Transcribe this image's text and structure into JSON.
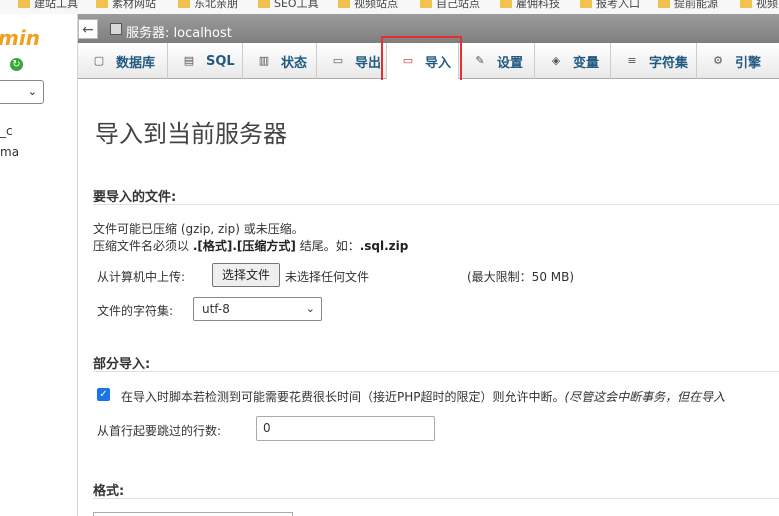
{
  "bookmarks": [
    "建站工具",
    "素材网站",
    "东北亲朋",
    "SEO工具",
    "视频站点",
    "自己站点",
    "雇佣科技",
    "报考入口",
    "提前能源",
    "视频"
  ],
  "sidebar": {
    "logo": "min",
    "items": [
      "_c",
      "ma"
    ]
  },
  "serverbar": {
    "back": "←",
    "label": "服务器: localhost"
  },
  "tabs": [
    {
      "label": "数据库",
      "icon": "database-icon"
    },
    {
      "label": "SQL",
      "icon": "sql-icon"
    },
    {
      "label": "状态",
      "icon": "status-icon"
    },
    {
      "label": "导出",
      "icon": "export-icon"
    },
    {
      "label": "导入",
      "icon": "import-icon"
    },
    {
      "label": "设置",
      "icon": "settings-icon"
    },
    {
      "label": "变量",
      "icon": "variables-icon"
    },
    {
      "label": "字符集",
      "icon": "charset-icon"
    },
    {
      "label": "引擎",
      "icon": "engine-icon"
    }
  ],
  "main": {
    "title": "导入到当前服务器",
    "file_section": {
      "heading": "要导入的文件:",
      "line1": "文件可能已压缩 (gzip, zip) 或未压缩。",
      "line2_prefix": "压缩文件名必须以 ",
      "line2_bold": ".[格式].[压缩方式]",
      "line2_mid": " 结尾。如：",
      "line2_example": ".sql.zip",
      "upload_label": "从计算机中上传:",
      "choose_button": "选择文件",
      "no_file": "未选择任何文件",
      "max_limit": "(最大限制：50 MB)",
      "charset_label": "文件的字符集:",
      "charset_value": "utf-8"
    },
    "partial_section": {
      "heading": "部分导入:",
      "checkbox_checked": true,
      "checkbox_text": "在导入时脚本若检测到可能需要花费很长时间（接近PHP超时的限定）则允许中断。",
      "checkbox_note": "(尽管这会中断事务，但在导入",
      "skip_label": "从首行起要跳过的行数:",
      "skip_value": "0"
    },
    "format_section": {
      "heading": "格式:"
    }
  },
  "colors": {
    "tab_text": "#235a81",
    "highlight": "#e53030",
    "checkbox": "#1a73e8"
  }
}
